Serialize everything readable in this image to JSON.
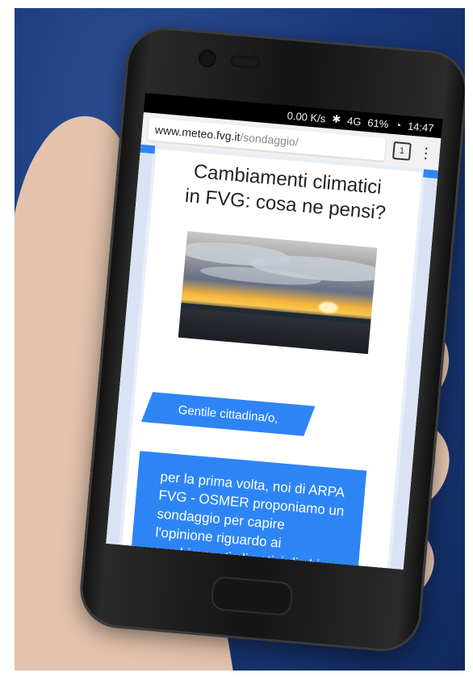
{
  "status_bar": {
    "network_speed": "0.00 K/s",
    "signal": "4G",
    "battery": "61%",
    "time": "14:47"
  },
  "browser": {
    "url_domain": "www.meteo.fvg.it",
    "url_path": "/sondaggio/",
    "tab_count": "1"
  },
  "page": {
    "title_line_1": "Cambiamenti climatici",
    "title_line_2": "in FVG: cosa ne pensi?",
    "greeting": "Gentile cittadina/o,",
    "intro_text": "per la prima volta, noi di ARPA FVG - OSMER proponiamo un sondaggio per capire l'opinione riguardo ai cambiamenti climatici di chi abita in Friuli Venezia Giulia."
  },
  "colors": {
    "accent": "#2d85f5",
    "background": "#1c3a7c"
  },
  "icons": {
    "bluetooth": "bluetooth-icon",
    "battery": "battery-icon",
    "menu": "more-vert-icon"
  }
}
